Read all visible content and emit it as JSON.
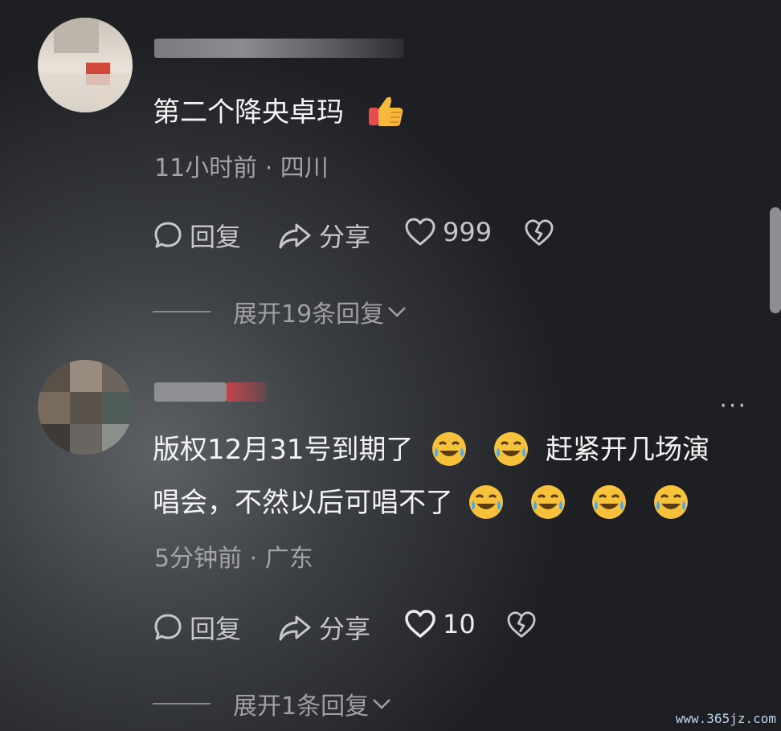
{
  "comments": [
    {
      "text": "第二个降央卓玛",
      "meta": "11小时前 · 四川",
      "reply_label": "回复",
      "share_label": "分享",
      "like_count": "999",
      "expand_label": "展开19条回复"
    },
    {
      "text_line1": "版权12月31号到期了",
      "text_line1b": "赶紧开几场演",
      "text_line2": "唱会，不然以后可唱不了",
      "meta": "5分钟前 · 广东",
      "reply_label": "回复",
      "share_label": "分享",
      "like_count": "10",
      "expand_label": "展开1条回复",
      "more_label": "···"
    }
  ],
  "watermark": "www.365jz.com",
  "icons": [
    "reply-bubble-icon",
    "share-arrow-icon",
    "heart-icon",
    "broken-heart-icon",
    "chevron-down-icon",
    "thumbs-up-emoji",
    "rofl-emoji"
  ]
}
